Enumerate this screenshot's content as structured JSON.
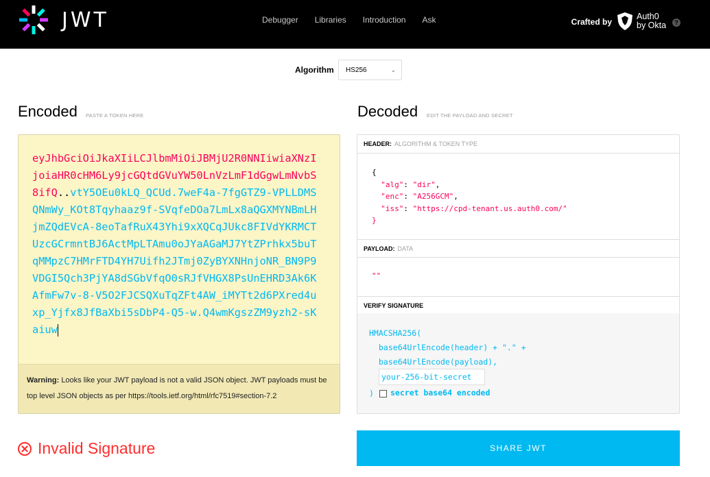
{
  "nav": {
    "brand": "JWT",
    "links": [
      "Debugger",
      "Libraries",
      "Introduction",
      "Ask"
    ],
    "crafted_by": "Crafted by",
    "auth0_line1": "Auth0",
    "auth0_line2": "by Okta",
    "help": "?"
  },
  "algorithm": {
    "label": "Algorithm",
    "selected": "HS256"
  },
  "encoded": {
    "title": "Encoded",
    "subtitle": "PASTE A TOKEN HERE",
    "token_header": "eyJhbGciOiJkaXIiLCJlbmMiOiJBMjU2R0NNIiwiaXNzIjoiaHR0cHM6Ly9jcGQtdGVuYW50LnVzLmF1dGgwLmNvbS8ifQ",
    "token_dot": "..",
    "token_payload": "vtY5OEu0kLQ_QCUd.7weF4a-7fgGTZ9-VPLLDMSQNmWy_KOt8Tqyhaaz9f-SVqfeDOa7LmLx8aQGXMYNBmLHjmZQdEVcA-8eoTafRuX43Yhi9xXQCqJUkc8FIVdYKRMCTUzcGCrmntBJ6ActMpLTAmu0oJYaAGaMJ7YtZPrhkx5buTqMMpzC7HMrFTD4YH7Uifh2JTmj0ZyBYXNHnjoNR_BN9P9VDGI5Qch3PjYA8dSGbVfqO0sRJfVHGX8PsUnEHRD3Ak6KAfmFw7v-8-V5O2FJCSQXuTqZFt4AW_iMYTt2d6PXred4uxp_Yjfx8JfBaXbi5sDbP4-Q5-w.Q4wmKgszZM9yzh2-sKaiuw",
    "warning_bold": "Warning:",
    "warning_text": "Looks like your JWT payload is not a valid JSON object. JWT payloads must be top level JSON objects as per https://tools.ietf.org/html/rfc7519#section-7.2"
  },
  "decoded": {
    "title": "Decoded",
    "subtitle": "EDIT THE PAYLOAD AND SECRET",
    "header_label": "HEADER:",
    "header_sub": "ALGORITHM & TOKEN TYPE",
    "header_json": {
      "open": "{",
      "alg_key": "\"alg\"",
      "alg_val": "\"dir\"",
      "enc_key": "\"enc\"",
      "enc_val": "\"A256GCM\"",
      "iss_key": "\"iss\"",
      "iss_val": "\"https://cpd-tenant.us.auth0.com/\"",
      "close": "}"
    },
    "payload_label": "PAYLOAD:",
    "payload_sub": "DATA",
    "payload_value": "\"\"",
    "verify_label": "VERIFY SIGNATURE",
    "sig_fn": "HMACSHA256(",
    "sig_line2": "base64UrlEncode(header) + \".\" +",
    "sig_line3": "base64UrlEncode(payload),",
    "secret_placeholder": "your-256-bit-secret",
    "sig_close": ")",
    "secret_base64_label": "secret base64 encoded"
  },
  "status": {
    "invalid_text": "Invalid Signature"
  },
  "share_label": "SHARE JWT"
}
